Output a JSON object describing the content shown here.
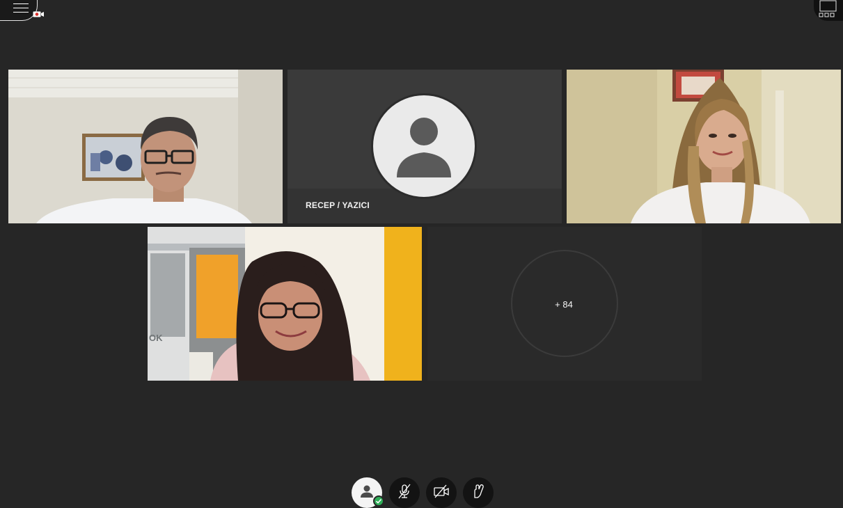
{
  "app": {
    "menu_icon": "hamburger-menu-icon",
    "recording_icon": "recording-camera-icon",
    "layout_icon": "grid-layout-icon"
  },
  "participants": [
    {
      "label": "",
      "video": true
    },
    {
      "label": "RECEP / YAZICI",
      "video": false
    },
    {
      "label": "",
      "video": true
    },
    {
      "label": "",
      "video": true
    }
  ],
  "overflow": {
    "label": "+ 84"
  },
  "controls": [
    {
      "icon": "user-status-icon",
      "status": "available"
    },
    {
      "icon": "microphone-muted-icon"
    },
    {
      "icon": "camera-off-icon"
    },
    {
      "icon": "raise-hand-icon"
    }
  ],
  "colors": {
    "background": "#262626",
    "status_green": "#2fae58",
    "recording_red": "#d9302c"
  }
}
